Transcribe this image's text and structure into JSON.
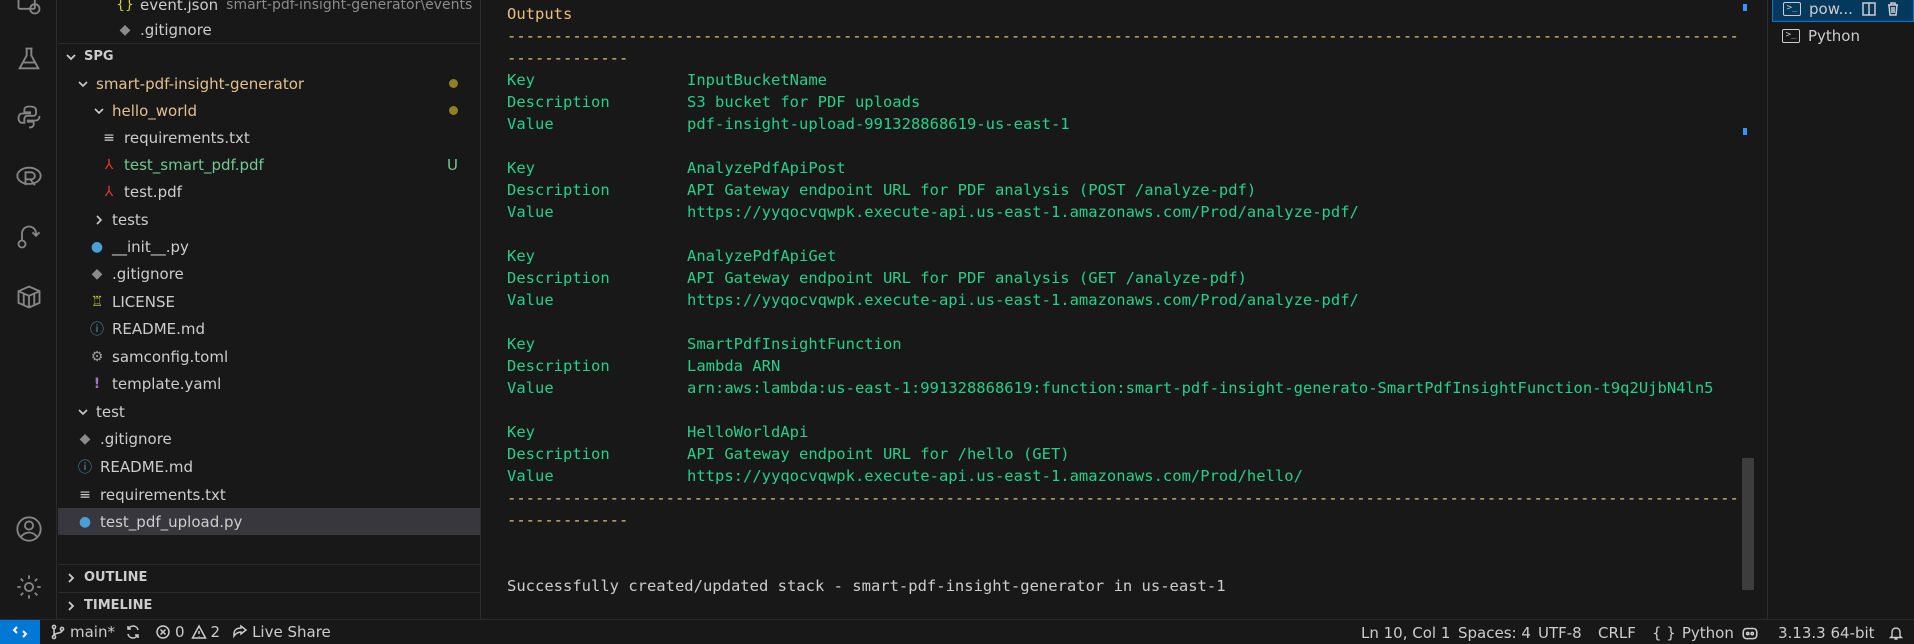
{
  "explorer": {
    "top_file": {
      "name": "event.json",
      "path": "smart-pdf-insight-generator\\events"
    },
    "top_gitignore": ".gitignore",
    "workspace_section": "SPG",
    "items": [
      {
        "label": "smart-pdf-insight-generator",
        "status": "modified"
      },
      {
        "label": "hello_world",
        "status": "modified"
      },
      {
        "label": "requirements.txt"
      },
      {
        "label": "test_smart_pdf.pdf",
        "badge": "U"
      },
      {
        "label": "test.pdf"
      },
      {
        "label": "tests"
      },
      {
        "label": "__init__.py"
      },
      {
        "label": ".gitignore"
      },
      {
        "label": "LICENSE"
      },
      {
        "label": "README.md"
      },
      {
        "label": "samconfig.toml"
      },
      {
        "label": "template.yaml"
      },
      {
        "label": "test"
      },
      {
        "label": ".gitignore"
      },
      {
        "label": "README.md"
      },
      {
        "label": "requirements.txt"
      },
      {
        "label": "test_pdf_upload.py"
      }
    ],
    "outline_label": "OUTLINE",
    "timeline_label": "TIMELINE"
  },
  "terminal": {
    "heading": "Outputs",
    "separator_top": "-----------------------------------------------------------------------------------------------------------------------------------------------------------------------------",
    "separator_top_wrap": "-------------",
    "key_label": "Key",
    "description_label": "Description",
    "value_label": "Value",
    "outputs": [
      {
        "key": "InputBucketName",
        "description": "S3 bucket for PDF uploads",
        "value": "pdf-insight-upload-991328868619-us-east-1"
      },
      {
        "key": "AnalyzePdfApiPost",
        "description": "API Gateway endpoint URL for PDF analysis (POST /analyze-pdf)",
        "value": "https://yyqocvqwpk.execute-api.us-east-1.amazonaws.com/Prod/analyze-pdf/"
      },
      {
        "key": "AnalyzePdfApiGet",
        "description": "API Gateway endpoint URL for PDF analysis (GET /analyze-pdf)",
        "value": "https://yyqocvqwpk.execute-api.us-east-1.amazonaws.com/Prod/analyze-pdf/"
      },
      {
        "key": "SmartPdfInsightFunction",
        "description": "Lambda ARN",
        "value": "arn:aws:lambda:us-east-1:991328868619:function:smart-pdf-insight-generato-SmartPdfInsightFunction-t9q2UjbN4ln5"
      },
      {
        "key": "HelloWorldApi",
        "description": "API Gateway endpoint URL for /hello (GET)",
        "value": "https://yyqocvqwpk.execute-api.us-east-1.amazonaws.com/Prod/hello/"
      }
    ],
    "separator_bottom": "-----------------------------------------------------------------------------------------------------------------------------------------------------------------------------",
    "separator_bottom_wrap": "-------------",
    "success": "Successfully created/updated stack - smart-pdf-insight-generator in us-east-1"
  },
  "terminal_list": [
    {
      "label": "pow...",
      "active": true
    },
    {
      "label": "Python",
      "active": false
    }
  ],
  "statusbar": {
    "branch": "main*",
    "errors": "0",
    "warnings": "2",
    "live_share": "Live Share",
    "position": "Ln 10, Col 1",
    "spaces": "Spaces: 4",
    "encoding": "UTF-8",
    "eol": "CRLF",
    "language": "Python",
    "interpreter": "3.13.3 64-bit"
  },
  "colors": {
    "accent": "#0078d4",
    "terminal_yellow": "#e5c07b",
    "terminal_green": "#23d18b",
    "modified": "#e2c08d",
    "untracked": "#73c991"
  }
}
